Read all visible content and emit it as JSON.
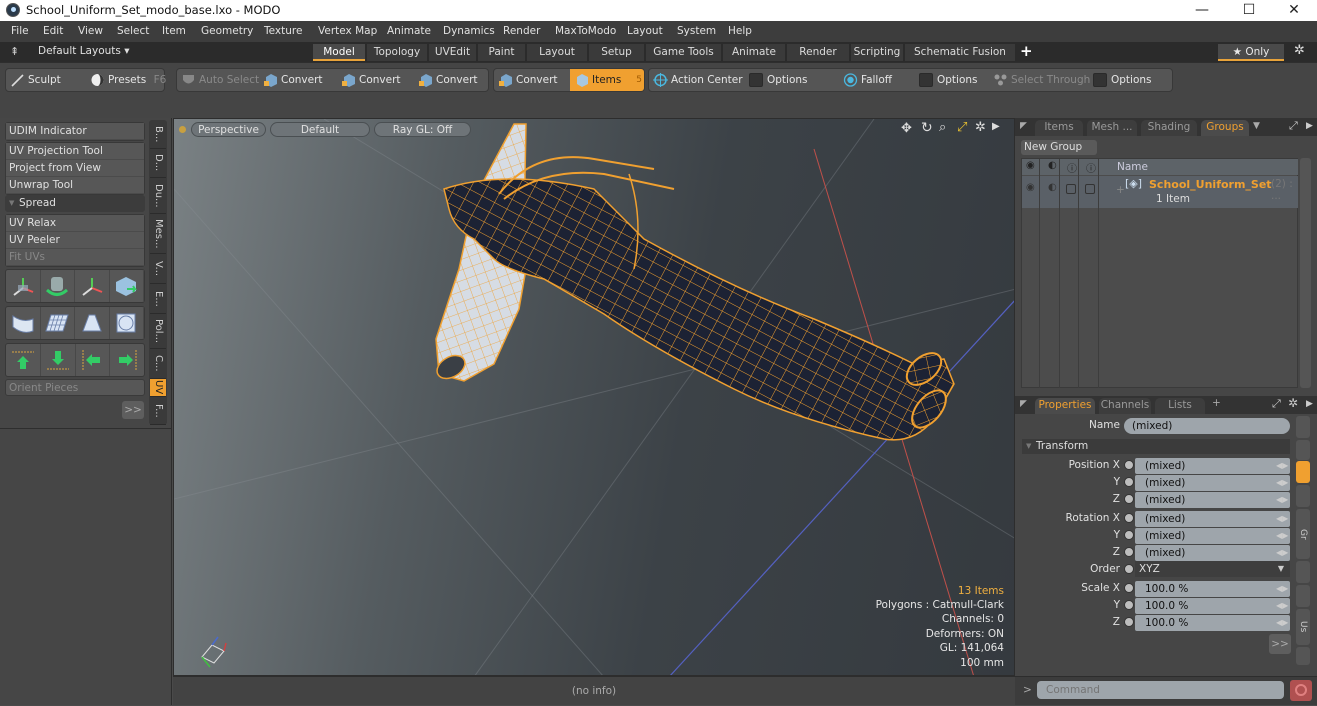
{
  "window": {
    "title": "School_Uniform_Set_modo_base.lxo - MODO",
    "controls": {
      "minimize": "—",
      "maximize": "☐",
      "close": "✕"
    }
  },
  "menu": [
    "File",
    "Edit",
    "View",
    "Select",
    "Item",
    "Geometry",
    "Texture",
    "Vertex Map",
    "Animate",
    "Dynamics",
    "Render",
    "MaxToModo",
    "Layout",
    "System",
    "Help"
  ],
  "layout_bar": {
    "layouts_label": "Default Layouts ▾",
    "tabs": [
      {
        "label": "Model",
        "active": true
      },
      {
        "label": "Topology"
      },
      {
        "label": "UVEdit"
      },
      {
        "label": "Paint"
      },
      {
        "label": "Layout"
      },
      {
        "label": "Setup"
      },
      {
        "label": "Game Tools"
      },
      {
        "label": "Animate"
      },
      {
        "label": "Render"
      },
      {
        "label": "Scripting"
      },
      {
        "label": "Schematic Fusion"
      }
    ],
    "add_tab": "+",
    "only_label": "★ Only",
    "gear": "✲"
  },
  "toolbar": {
    "sculpt": "Sculpt",
    "presets": "Presets",
    "presets_key": "F6",
    "auto_select": "Auto Select",
    "convert_1": "Convert",
    "convert_2": "Convert",
    "convert_3": "Convert",
    "convert_4": "Convert",
    "items": "Items",
    "items_key": "5",
    "action_center": "Action Center",
    "options_1": "Options",
    "falloff": "Falloff",
    "options_2": "Options",
    "select_through": "Select Through",
    "options_3": "Options"
  },
  "left_panel": {
    "udim": "UDIM Indicator",
    "tools": [
      "UV Projection Tool",
      "Project from View",
      "Unwrap Tool"
    ],
    "spread": "Spread",
    "relax_tools": [
      "UV Relax",
      "UV Peeler",
      "Fit UVs"
    ],
    "orient": "Orient Pieces",
    "more": ">>",
    "vtabs": [
      {
        "label": "B..."
      },
      {
        "label": "D..."
      },
      {
        "label": "Du..."
      },
      {
        "label": "Mes..."
      },
      {
        "label": "V..."
      },
      {
        "label": "E..."
      },
      {
        "label": "Pol..."
      },
      {
        "label": "C..."
      },
      {
        "label": "UV",
        "active": true
      },
      {
        "label": "F..."
      }
    ]
  },
  "viewport": {
    "view_mode": "Perspective",
    "shading": "Default",
    "raygl": "Ray GL: Off",
    "info": {
      "items": "13 Items",
      "polygons": "Polygons : Catmull-Clark",
      "channels": "Channels: 0",
      "deformers": "Deformers: ON",
      "gl": "GL: 141,064",
      "scale": "100 mm"
    },
    "wire_color": "#f0a030",
    "mesh_color": "#1c2234"
  },
  "status": "(no info)",
  "right_panel": {
    "top_tabs": [
      {
        "label": "Items"
      },
      {
        "label": "Mesh ..."
      },
      {
        "label": "Shading"
      },
      {
        "label": "Groups",
        "active": true
      }
    ],
    "new_group": "New Group",
    "list_header": "Name",
    "group": {
      "name": "School_Uniform_Set",
      "count": "(2) : ...",
      "sub": "1 Item"
    },
    "prop_tabs": [
      {
        "label": "Properties",
        "active": true
      },
      {
        "label": "Channels"
      },
      {
        "label": "Lists"
      },
      {
        "label": "+"
      }
    ],
    "name_label": "Name",
    "name_value": "(mixed)",
    "transform_label": "Transform",
    "position": {
      "label": "Position X",
      "x": "(mixed)",
      "y": "(mixed)",
      "z": "(mixed)"
    },
    "rotation": {
      "label": "Rotation X",
      "x": "(mixed)",
      "y": "(mixed)",
      "z": "(mixed)"
    },
    "order": {
      "label": "Order",
      "value": "XYZ"
    },
    "scale": {
      "label": "Scale X",
      "x": "100.0 %",
      "y": "100.0 %",
      "z": "100.0 %"
    },
    "axis_y": "Y",
    "axis_z": "Z",
    "more": ">>",
    "side_tabs": [
      "Gr",
      "Us"
    ],
    "command_prompt": ">",
    "command_placeholder": "Command"
  }
}
